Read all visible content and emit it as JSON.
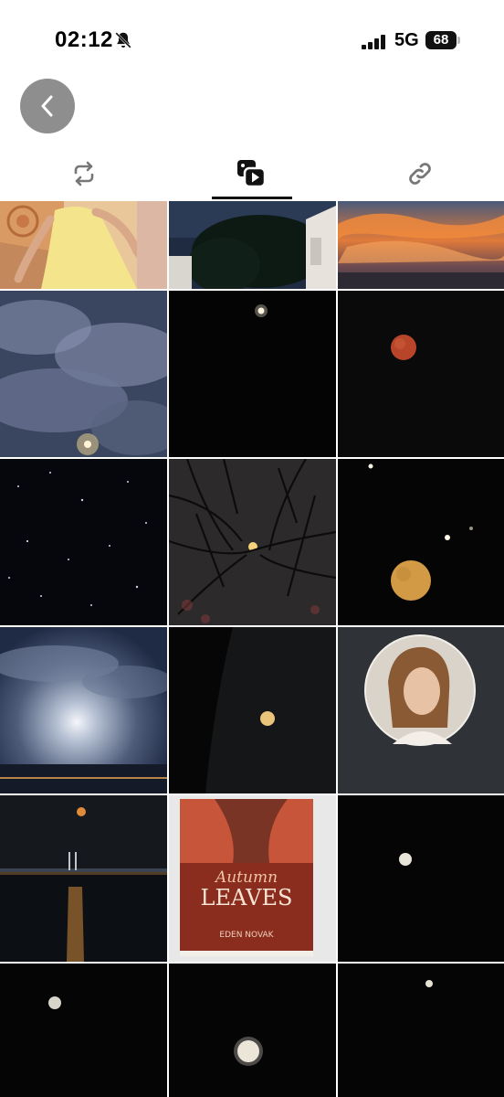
{
  "status_bar": {
    "time": "02:12",
    "network": "5G",
    "battery": "68"
  },
  "icons": {
    "back": "chevron-left-icon",
    "tab_reposts": "repost-icon",
    "tab_media": "media-icon",
    "tab_links": "link-icon",
    "bell": "bell-slash-icon"
  },
  "tabs": {
    "active": "media"
  },
  "book": {
    "title_line1": "Autumn",
    "title_line2": "LEAVES",
    "author": "EDEN NOVAK"
  },
  "colors": {
    "back_button": "#8e8e8e",
    "tab_indicator": "#111111",
    "moon": "#f2e6c8",
    "blood_moon": "#b8452a"
  }
}
